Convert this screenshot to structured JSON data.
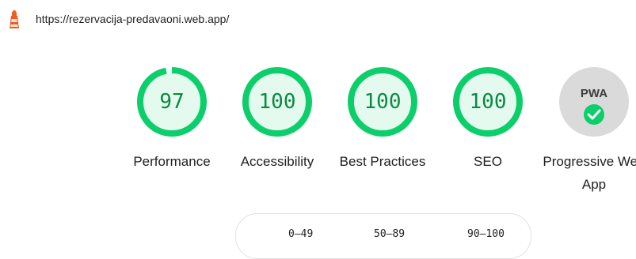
{
  "header": {
    "url": "https://rezervacija-predavaoni.web.app/",
    "icon": "lighthouse-icon"
  },
  "colors": {
    "pass": "#0cce6b",
    "pass_fill": "#e5faef",
    "pass_text": "#0b8a43",
    "pwa_bg": "#dadada"
  },
  "gauges": [
    {
      "score": "97",
      "value": 97,
      "label": "Performance"
    },
    {
      "score": "100",
      "value": 100,
      "label": "Accessibility"
    },
    {
      "score": "100",
      "value": 100,
      "label": "Best Practices"
    },
    {
      "score": "100",
      "value": 100,
      "label": "SEO"
    }
  ],
  "pwa": {
    "badge_text": "PWA",
    "icon": "checkmark-icon",
    "label": "Progressive Web App"
  },
  "legend": {
    "ranges": [
      "0–49",
      "50–89",
      "90–100"
    ]
  }
}
